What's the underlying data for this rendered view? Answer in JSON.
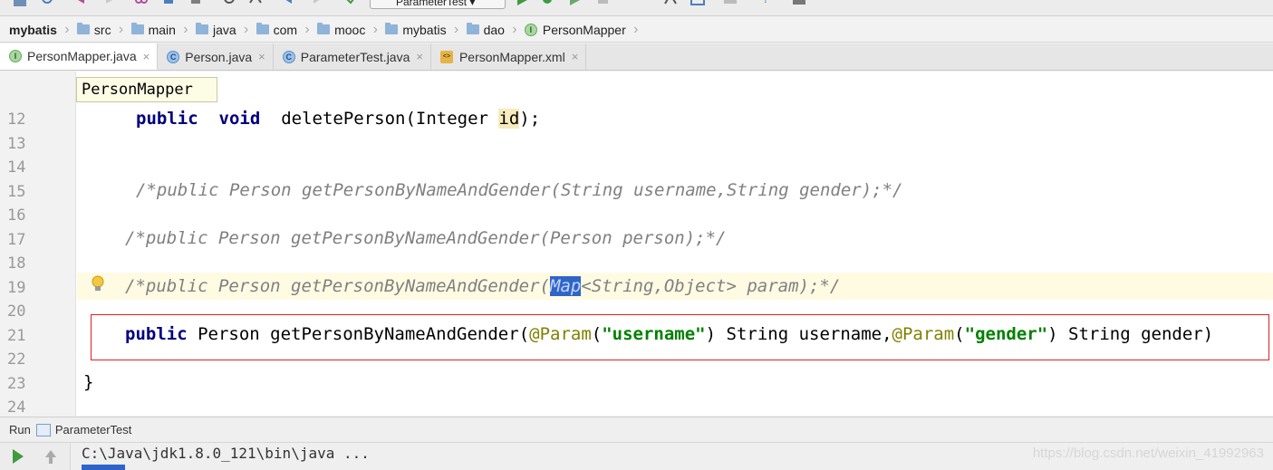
{
  "toolbar": {
    "run_config_label": "ParameterTest"
  },
  "breadcrumb": {
    "items": [
      "mybatis",
      "src",
      "main",
      "java",
      "com",
      "mooc",
      "mybatis",
      "dao",
      "PersonMapper"
    ]
  },
  "tabs": [
    {
      "label": "PersonMapper.java",
      "icon": "interface-icon",
      "active": true
    },
    {
      "label": "Person.java",
      "icon": "class-icon",
      "active": false
    },
    {
      "label": "ParameterTest.java",
      "icon": "test-class-icon",
      "active": false
    },
    {
      "label": "PersonMapper.xml",
      "icon": "xml-file-icon",
      "active": false
    }
  ],
  "editor": {
    "context_popup": "PersonMapper",
    "line_numbers": [
      "12",
      "13",
      "14",
      "15",
      "16",
      "17",
      "18",
      "19",
      "20",
      "21",
      "22",
      "23",
      "24"
    ],
    "line12": {
      "kw1": "public",
      "kw2": "void",
      "text": "deletePerson(Integer ",
      "param": "id",
      "end": ");"
    },
    "line15": "/*public Person getPersonByNameAndGender(String username,String gender);*/",
    "line17": "/*public Person getPersonByNameAndGender(Person person);*/",
    "line19": {
      "before": "/*public Person getPersonByNameAndGender(",
      "selected": "Map",
      "after": "<String,Object> param);*/"
    },
    "line21": {
      "kw": "public",
      "t1": " Person getPersonByNameAndGender(",
      "ann1": "@Param",
      "p1": "(",
      "s1": "\"username\"",
      "t2": ") String username,",
      "ann2": "@Param",
      "p2": "(",
      "s2": "\"gender\"",
      "t3": ") String gender)"
    },
    "line23": "}",
    "colors": {
      "keyword": "#000080",
      "comment": "#808080",
      "annotation": "#808000",
      "string": "#008000",
      "highlight_box": "#e02020"
    }
  },
  "run_panel": {
    "label": "Run",
    "tab_label": "ParameterTest",
    "output_line": "C:\\Java\\jdk1.8.0_121\\bin\\java ...",
    "watermark": "https://blog.csdn.net/weixin_41992963"
  }
}
